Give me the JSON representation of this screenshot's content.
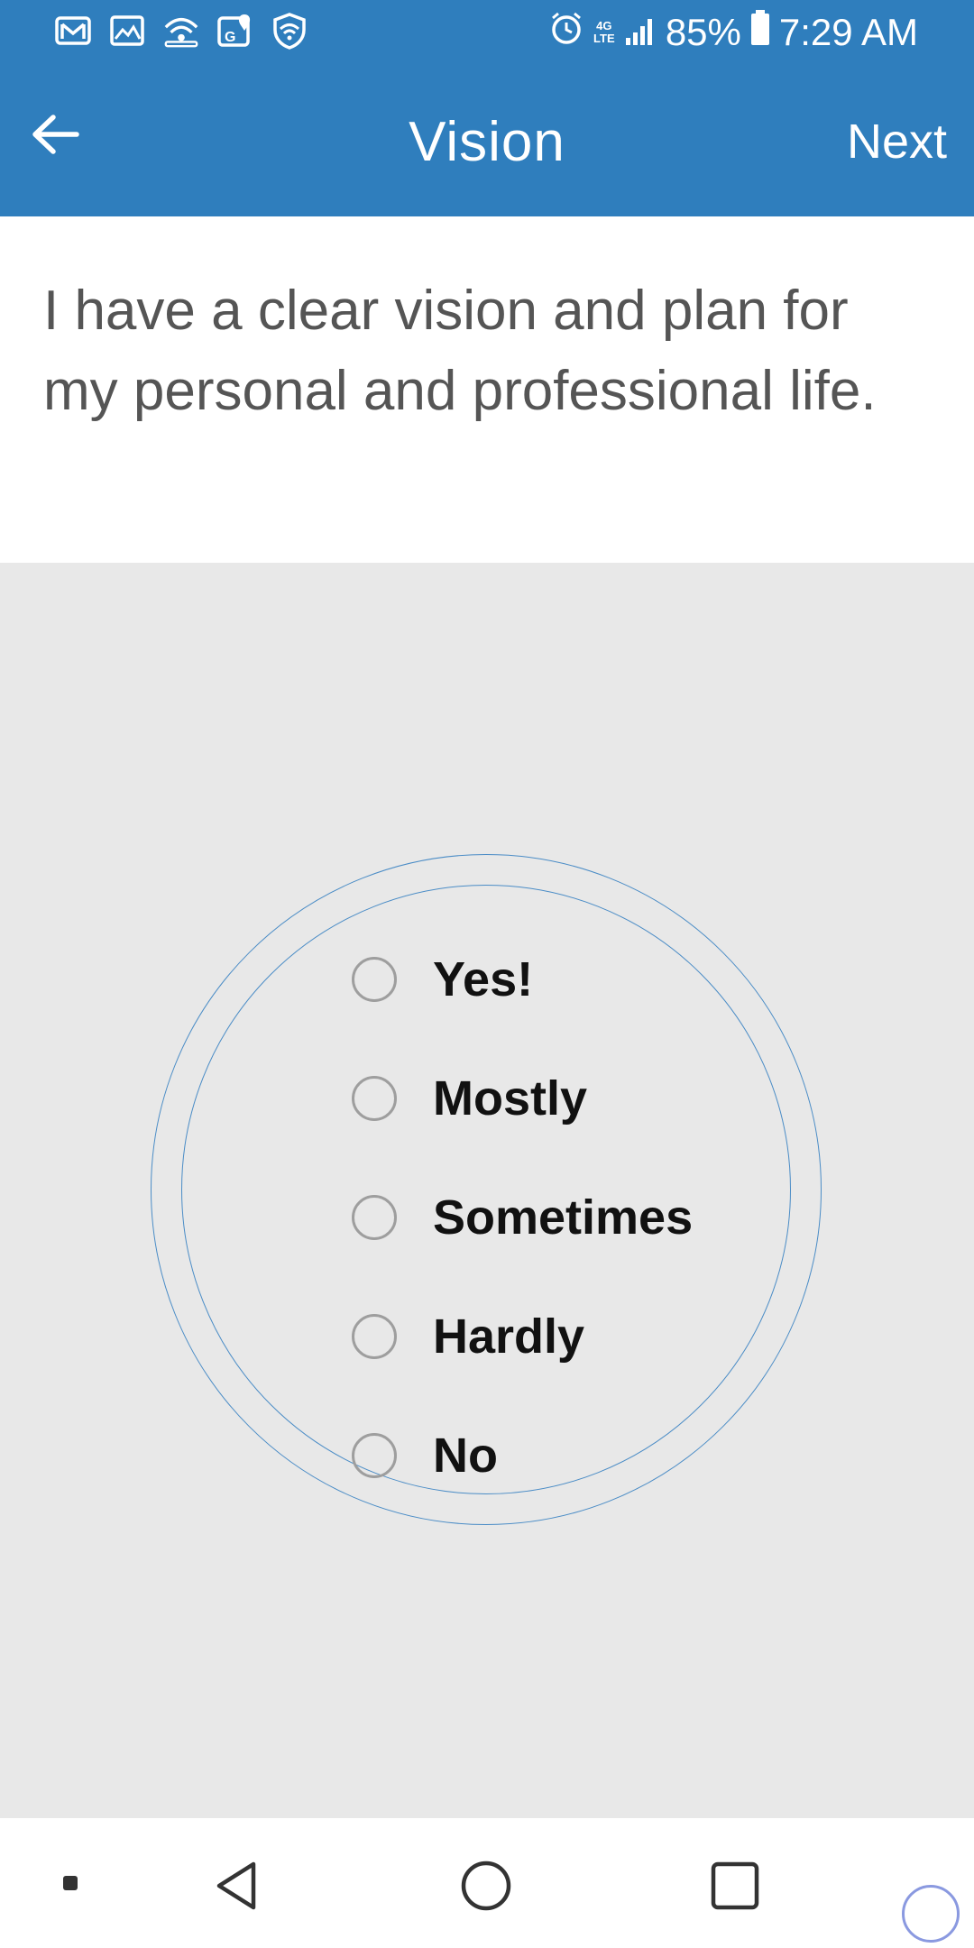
{
  "status_bar": {
    "battery": "85%",
    "time": "7:29 AM",
    "network": "4G LTE",
    "left_icons": [
      "gmail-icon",
      "gallery-icon",
      "wifi-hotspot-icon",
      "maps-icon",
      "vpn-shield-icon"
    ],
    "right_icons": [
      "alarm-icon",
      "signal-icon",
      "battery-icon"
    ]
  },
  "app_bar": {
    "title": "Vision",
    "next_label": "Next",
    "back_icon": "arrow-left-icon"
  },
  "question": {
    "text": "I have a clear vision and plan for my personal and professional life."
  },
  "options": [
    {
      "label": "Yes!",
      "selected": false
    },
    {
      "label": "Mostly",
      "selected": false
    },
    {
      "label": "Sometimes",
      "selected": false
    },
    {
      "label": "Hardly",
      "selected": false
    },
    {
      "label": "No",
      "selected": false
    }
  ],
  "colors": {
    "primary": "#2f7ebd",
    "ring": "#4a8cc6",
    "background": "#e8e8e8",
    "question_text": "#555555",
    "radio_border": "#9e9e9e"
  },
  "nav_bar": {
    "icons": [
      "dot-icon",
      "back-triangle-icon",
      "home-circle-icon",
      "recents-square-icon"
    ]
  }
}
